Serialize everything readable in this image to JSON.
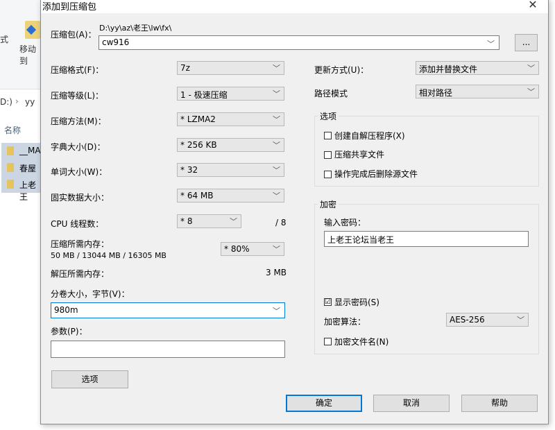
{
  "background": {
    "ribbon_label_1": "式",
    "ribbon_label_2": "移动到",
    "path_prefix": "D:)",
    "path_sep": "›",
    "path_crumb": "yy",
    "col_name": "名称",
    "rows": [
      "__MA",
      "春屋",
      "上老王"
    ]
  },
  "dialog": {
    "title": "添加到压缩包",
    "close": "✕",
    "archive_label": "压缩包(A)：",
    "archive_path": "D:\\yy\\az\\老王\\lw\\fx\\",
    "archive_name": "cw916",
    "browse_label": "...",
    "format_label": "压缩格式(F)：",
    "format_value": "7z",
    "level_label": "压缩等级(L)：",
    "level_value": "1 - 极速压缩",
    "method_label": "压缩方法(M)：",
    "method_value": "* LZMA2",
    "dict_label": "字典大小(D)：",
    "dict_value": "* 256 KB",
    "word_label": "单词大小(W)：",
    "word_value": "* 32",
    "solid_label": "固实数据大小：",
    "solid_value": "* 64 MB",
    "threads_label": "CPU 线程数：",
    "threads_value": "* 8",
    "threads_total": "/ 8",
    "mem_comp_label": "压缩所需内存：",
    "mem_comp_detail": "50 MB / 13044 MB / 16305 MB",
    "mem_comp_value": "* 80%",
    "mem_decomp_label": "解压所需内存：",
    "mem_decomp_value": "3 MB",
    "volume_label": "分卷大小，字节(V)：",
    "volume_value": "980m",
    "params_label": "参数(P)：",
    "params_value": "",
    "options_button": "选项",
    "update_label": "更新方式(U)：",
    "update_value": "添加并替换文件",
    "pathmode_label": "路径模式",
    "pathmode_value": "相对路径",
    "options_group": "选项",
    "opt_sfx": "创建自解压程序(X)",
    "opt_shared": "压缩共享文件",
    "opt_delete": "操作完成后删除源文件",
    "encrypt_group": "加密",
    "password_label": "输入密码：",
    "password_value": "上老王论坛当老王",
    "show_password": "显示密码(S)",
    "show_password_checked": "☑",
    "enc_method_label": "加密算法：",
    "enc_method_value": "AES-256",
    "encrypt_names": "加密文件名(N)",
    "ok": "确定",
    "cancel": "取消",
    "help": "帮助"
  },
  "colors": {
    "accent": "#0078d7",
    "dialog_bg": "#f0f0f0"
  }
}
